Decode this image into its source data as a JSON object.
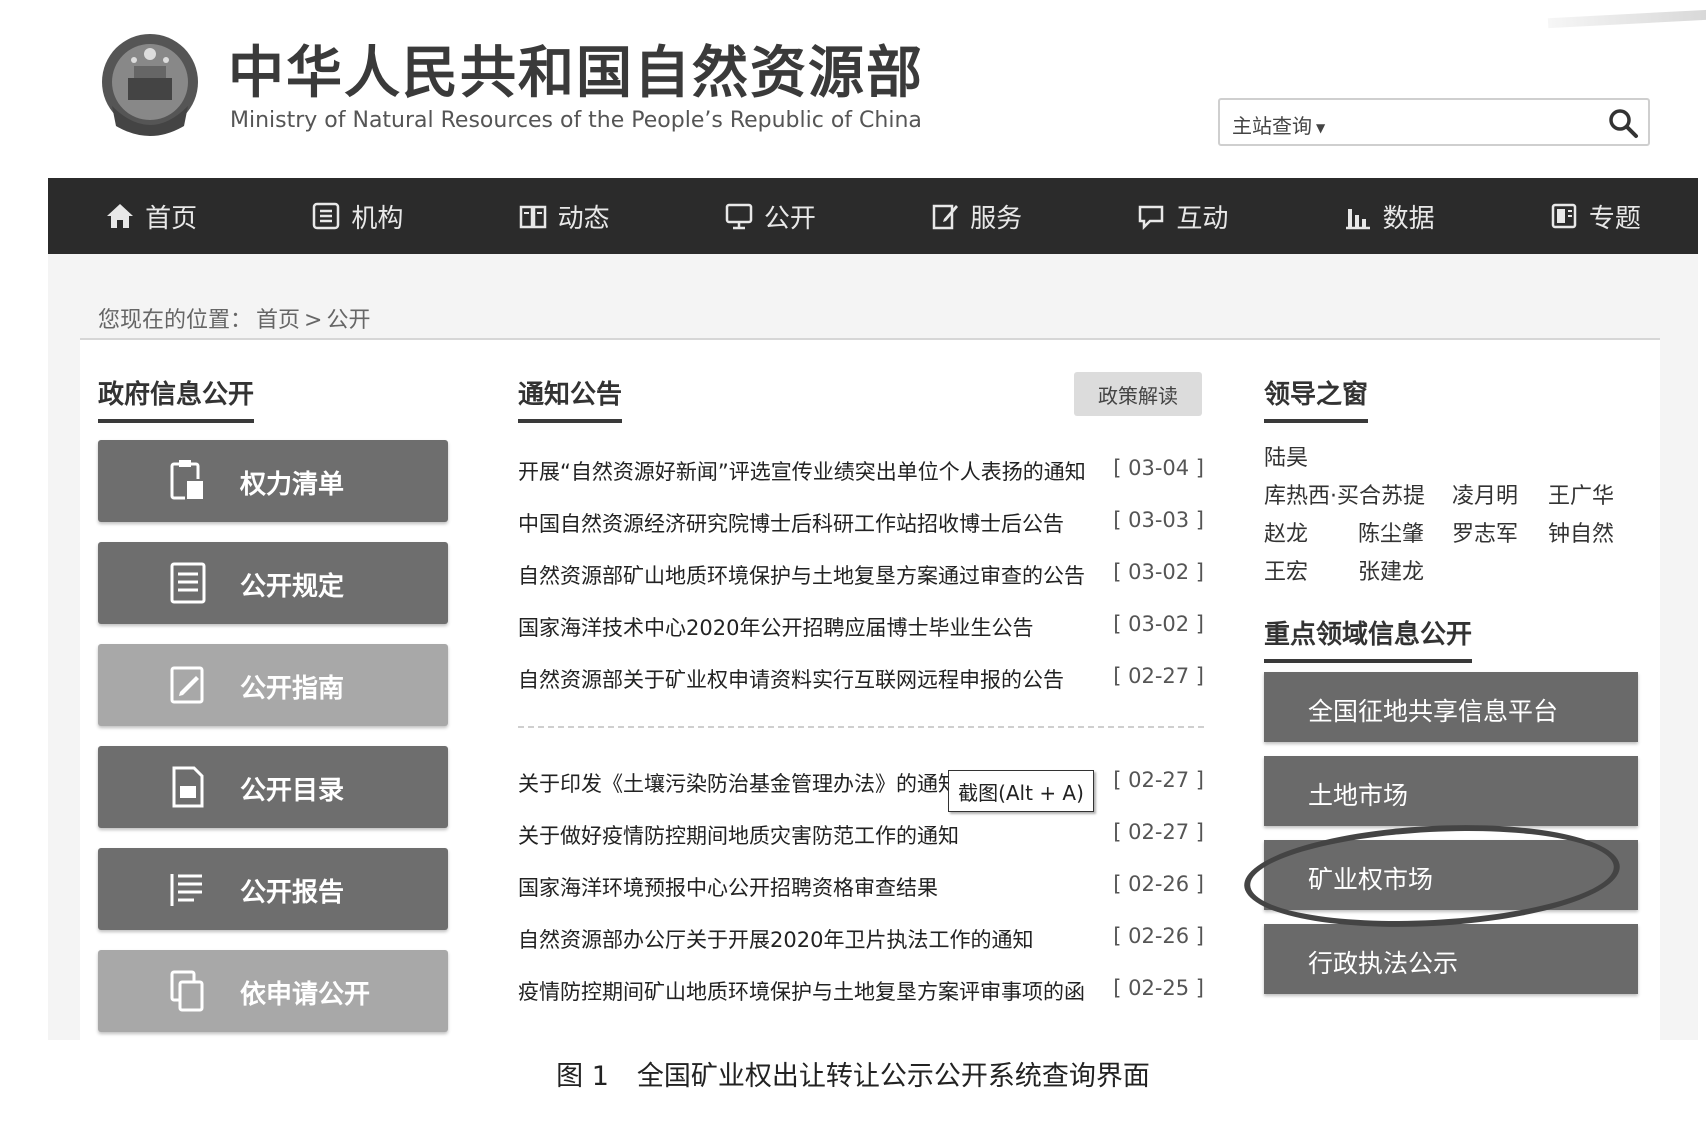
{
  "header": {
    "title": "中华人民共和国自然资源部",
    "subtitle": "Ministry of Natural Resources of the People’s Republic of China",
    "emblem_icon": "national-emblem-icon"
  },
  "search": {
    "scope_label": "主站查询",
    "placeholder": "",
    "button_icon": "search-icon"
  },
  "nav": {
    "items": [
      {
        "label": "首页",
        "icon": "home-icon"
      },
      {
        "label": "机构",
        "icon": "organization-icon"
      },
      {
        "label": "动态",
        "icon": "book-icon"
      },
      {
        "label": "公开",
        "icon": "monitor-icon"
      },
      {
        "label": "服务",
        "icon": "edit-icon"
      },
      {
        "label": "互动",
        "icon": "chat-icon"
      },
      {
        "label": "数据",
        "icon": "bar-chart-icon"
      },
      {
        "label": "专题",
        "icon": "folder-icon"
      }
    ]
  },
  "breadcrumb": {
    "prefix": "您现在的位置：",
    "home": "首页",
    "separator": ">",
    "current": "公开"
  },
  "gov_info": {
    "title": "政府信息公开",
    "buttons": [
      {
        "label": "权力清单",
        "icon": "clipboard-icon"
      },
      {
        "label": "公开规定",
        "icon": "document-list-icon"
      },
      {
        "label": "公开指南",
        "icon": "edit-note-icon"
      },
      {
        "label": "公开目录",
        "icon": "file-icon"
      },
      {
        "label": "公开报告",
        "icon": "report-list-icon"
      },
      {
        "label": "依申请公开",
        "icon": "copy-document-icon"
      }
    ]
  },
  "notices": {
    "title": "通知公告",
    "policy_button": "政策解读",
    "group1": [
      {
        "title": "开展“自然资源好新闻”评选宣传业绩突出单位个人表扬的通知",
        "date": "[ 03-04 ]"
      },
      {
        "title": "中国自然资源经济研究院博士后科研工作站招收博士后公告",
        "date": "[ 03-03 ]"
      },
      {
        "title": "自然资源部矿山地质环境保护与土地复垦方案通过审查的公告",
        "date": "[ 03-02 ]"
      },
      {
        "title": "国家海洋技术中心2020年公开招聘应届博士毕业生公告",
        "date": "[ 03-02 ]"
      },
      {
        "title": "自然资源部关于矿业权申请资料实行互联网远程申报的公告",
        "date": "[ 02-27 ]"
      }
    ],
    "group2": [
      {
        "title": "关于印发《土壤污染防治基金管理办法》的通知",
        "date": "[ 02-27 ]"
      },
      {
        "title": "关于做好疫情防控期间地质灾害防范工作的通知",
        "date": "[ 02-27 ]"
      },
      {
        "title": "国家海洋环境预报中心公开招聘资格审查结果",
        "date": "[ 02-26 ]"
      },
      {
        "title": "自然资源部办公厅关于开展2020年卫片执法工作的通知",
        "date": "[ 02-26 ]"
      },
      {
        "title": "疫情防控期间矿山地质环境保护与土地复垦方案评审事项的函",
        "date": "[ 02-25 ]"
      }
    ],
    "tooltip": "截图(Alt + A)"
  },
  "leaders": {
    "title": "领导之窗",
    "names": [
      "陆昊",
      "库热西·买合苏提",
      "凌月明",
      "王广华",
      "赵龙",
      "陈尘肇",
      "罗志军",
      "钟自然",
      "王宏",
      "张建龙"
    ]
  },
  "key_areas": {
    "title": "重点领域信息公开",
    "buttons": [
      {
        "label": "全国征地共享信息平台"
      },
      {
        "label": "土地市场"
      },
      {
        "label": "矿业权市场"
      },
      {
        "label": "行政执法公示"
      }
    ]
  },
  "caption": {
    "figure": "图 1",
    "text": "全国矿业权出让转让公示公开系统查询界面"
  }
}
